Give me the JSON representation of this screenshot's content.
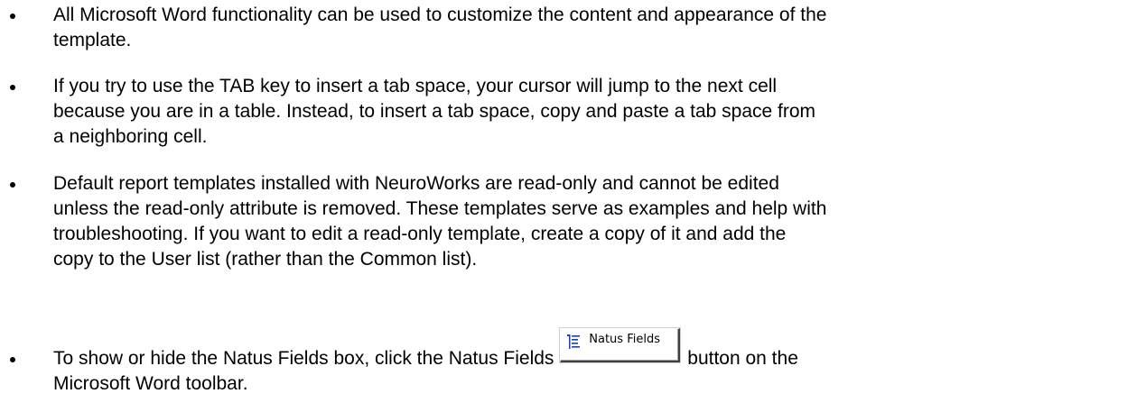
{
  "bullets": [
    {
      "lines": [
        "All Microsoft Word functionality can be used to customize the content and appearance of the",
        "template."
      ]
    },
    {
      "lines": [
        "If you try to use the TAB key to insert a tab space, your cursor will jump to the next cell",
        "because you are in a table. Instead, to insert a tab space, copy and paste a tab space from",
        "a neighboring cell."
      ]
    },
    {
      "lines": [
        "Default report templates installed with NeuroWorks are read-only and cannot be edited",
        "unless the read-only attribute is removed. These templates serve as examples and help with",
        "troubleshooting. If you want to edit a read-only template, create a copy of it and add the",
        "copy to the User list (rather than the Common list)."
      ]
    },
    {
      "line1_before": "To show or hide the Natus Fields box, click the Natus Fields ",
      "line1_after": "button on the",
      "line2": "Microsoft Word toolbar.",
      "toolbar_button": {
        "label": "Natus Fields",
        "icon": "natus-fields-icon"
      }
    }
  ]
}
